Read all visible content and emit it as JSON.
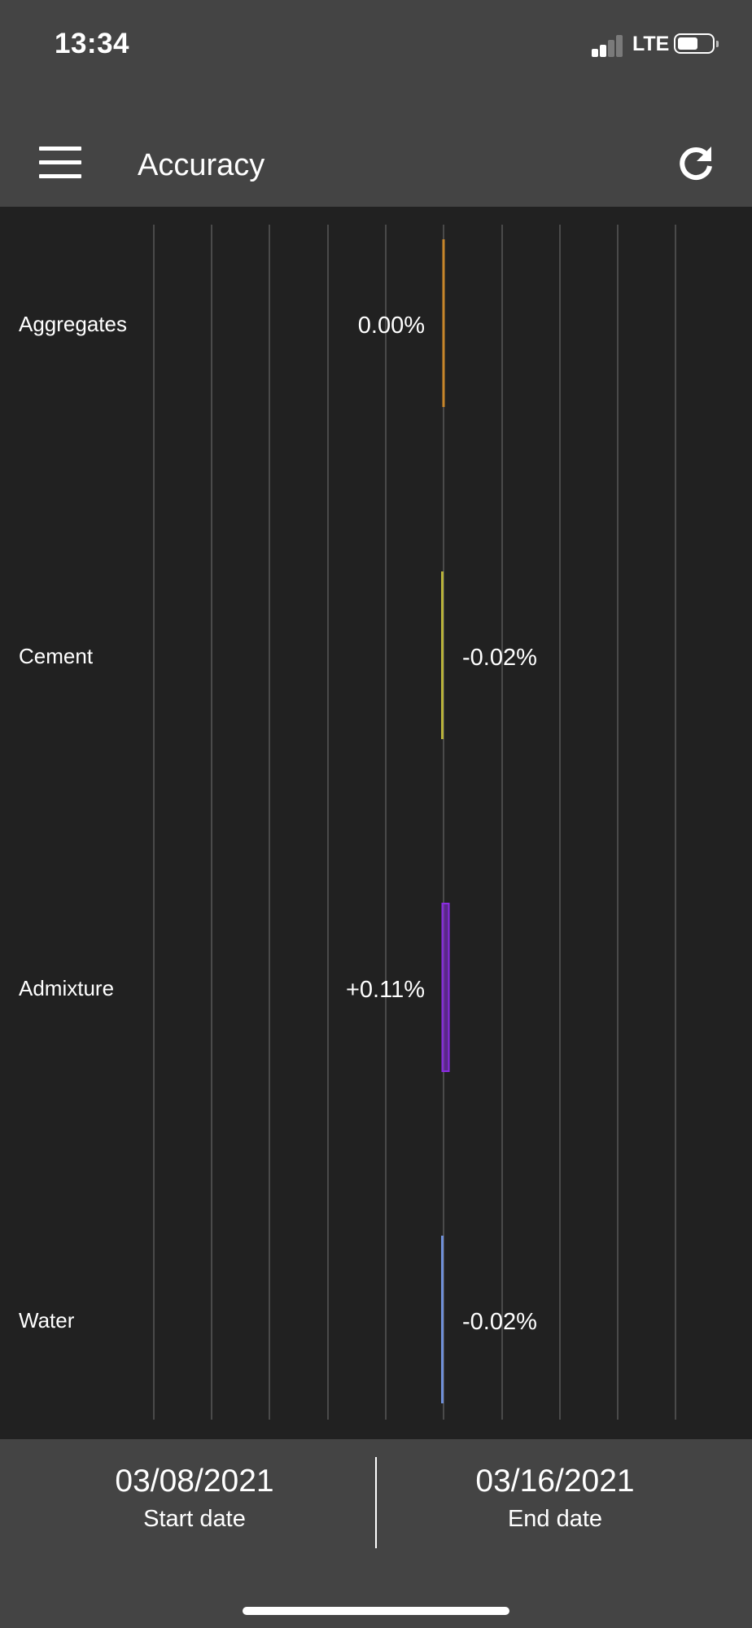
{
  "status_bar": {
    "time": "13:34",
    "network": "LTE",
    "signal_icon": "signal-icon",
    "battery_icon": "battery-icon"
  },
  "app_bar": {
    "title": "Accuracy",
    "menu_icon": "hamburger-menu-icon",
    "refresh_icon": "refresh-icon"
  },
  "chart_data": {
    "type": "bar",
    "orientation": "horizontal",
    "grid": true,
    "categories": [
      "Aggregates",
      "Cement",
      "Admixture",
      "Water"
    ],
    "values": [
      0.0,
      -0.02,
      0.11,
      -0.02
    ],
    "labels": [
      "0.00%",
      "-0.02%",
      "+0.11%",
      "-0.02%"
    ],
    "colors": [
      "#c8862a",
      "#b8b23a",
      "#8a2be2",
      "#6f8fd8"
    ],
    "unit": "%"
  },
  "footer": {
    "start_date": "03/08/2021",
    "start_label": "Start date",
    "end_date": "03/16/2021",
    "end_label": "End date"
  }
}
